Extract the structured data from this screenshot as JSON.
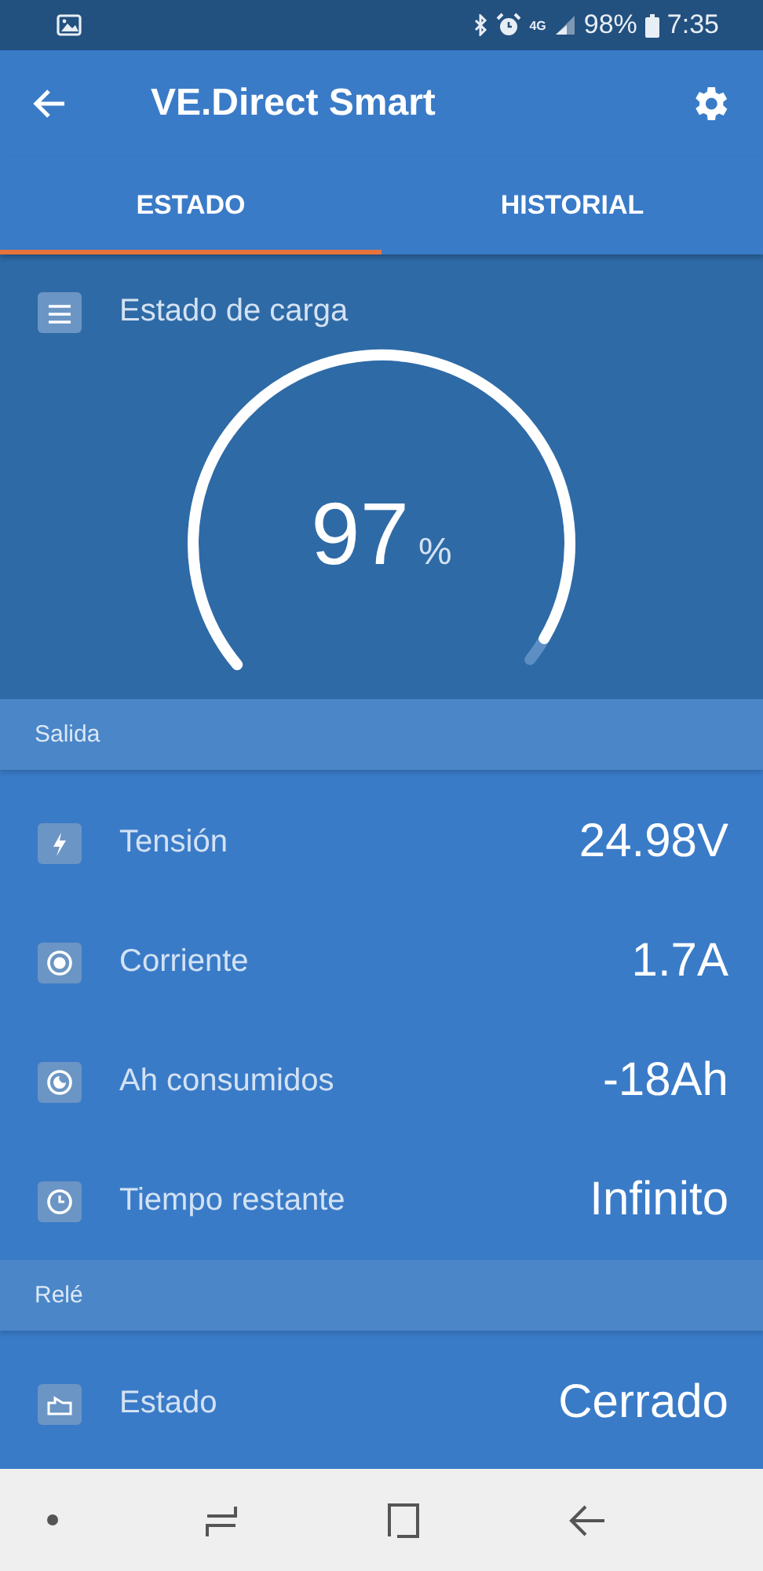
{
  "status_bar": {
    "network": "4G",
    "battery": "98%",
    "time": "7:35"
  },
  "app_bar": {
    "title": "VE.Direct Smart"
  },
  "tabs": [
    {
      "label": "ESTADO",
      "selected": true
    },
    {
      "label": "HISTORIAL",
      "selected": false
    }
  ],
  "charge": {
    "label": "Estado de carga",
    "value": "97",
    "unit": "%"
  },
  "sections": [
    {
      "title": "Salida",
      "rows": [
        {
          "kind": "voltage",
          "label": "Tensión",
          "value": "24.98V"
        },
        {
          "kind": "current",
          "label": "Corriente",
          "value": "1.7A"
        },
        {
          "kind": "consumed",
          "label": "Ah consumidos",
          "value": "-18Ah"
        },
        {
          "kind": "time",
          "label": "Tiempo restante",
          "value": "Infinito"
        }
      ]
    },
    {
      "title": "Relé",
      "rows": [
        {
          "kind": "relay",
          "label": "Estado",
          "value": "Cerrado"
        }
      ]
    }
  ]
}
